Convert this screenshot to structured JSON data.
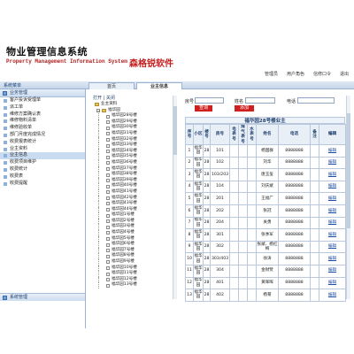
{
  "header": {
    "title": "物业管理信息系统",
    "subtitle": "Property Management Information System -",
    "brand": "森格锐软件",
    "links": [
      "管理员",
      "用户角色",
      "信修口令",
      "退出"
    ]
  },
  "strip": {
    "label": "系统菜单",
    "tabs": [
      "首页",
      "业主信息"
    ]
  },
  "sidebar": {
    "group": "业务管理",
    "items": [
      "客户投诉受理单",
      "派工单",
      "维修方案确认表",
      "维修物料清单",
      "维修验收单",
      "部门月度完成情况",
      "收费报表统计",
      "业主资料",
      "业主信息",
      "收费项目维护",
      "收费统计",
      "收费表",
      "收费提醒"
    ],
    "active_index": 8,
    "bottom_group": "系统管理"
  },
  "tree": {
    "tools": "打开 | 关闭",
    "root": "业主资料",
    "building": "福华园",
    "leaves": [
      "福华园28号楼",
      "福华园29号楼",
      "福华园30号楼",
      "福华园31号楼",
      "福华园32号楼",
      "福华园33号楼",
      "福华园34号楼",
      "福华园35号楼",
      "福华园36号楼",
      "福华园37号楼",
      "福华园38号楼",
      "福华园39号楼",
      "福华园40号楼",
      "福华园41号楼",
      "福华园42号楼",
      "福华园43号楼",
      "福华园44号楼",
      "福华园1号楼",
      "福华园2号楼",
      "福华园3号楼",
      "福华园4号楼",
      "福华园5号楼",
      "福华园6号楼",
      "福华园7号楼",
      "福华园8号楼",
      "福华园9号楼",
      "福华园10号楼",
      "福华园11号楼",
      "福华园12号楼",
      "福华园13号楼"
    ]
  },
  "filter": {
    "room_label": "房号",
    "name_label": "姓名",
    "phone_label": "电话",
    "room_value": "",
    "name_value": "",
    "phone_value": "",
    "search_label": "查询",
    "add_label": "添加"
  },
  "table": {
    "title": "福华园28号楼业主",
    "headers": [
      "序号",
      "小区",
      "楼号",
      "房号",
      "电表号",
      "煤气表号",
      "水表号",
      "姓名",
      "电话",
      "备注",
      "编辑"
    ],
    "rows": [
      [
        "1",
        "福华园",
        "28",
        "101",
        "",
        "",
        "",
        "杨国群",
        "8888888",
        "",
        "编辑"
      ],
      [
        "2",
        "福华园",
        "28",
        "102",
        "",
        "",
        "",
        "刘华",
        "8888888",
        "",
        "编辑"
      ],
      [
        "3",
        "福华园",
        "28",
        "103/203",
        "",
        "",
        "",
        "唐玉玺",
        "8888888",
        "",
        "编辑"
      ],
      [
        "4",
        "福华园",
        "28",
        "104",
        "",
        "",
        "",
        "刘庆斌",
        "8888888",
        "",
        "编辑"
      ],
      [
        "5",
        "福华园",
        "28",
        "201",
        "",
        "",
        "",
        "王福广",
        "8888888",
        "",
        "编辑"
      ],
      [
        "6",
        "福华园",
        "28",
        "202",
        "",
        "",
        "",
        "张冠",
        "8888888",
        "",
        "编辑"
      ],
      [
        "7",
        "福华园",
        "28",
        "204",
        "",
        "",
        "",
        "关勇",
        "8888888",
        "",
        "编辑"
      ],
      [
        "8",
        "福华园",
        "28",
        "301",
        "",
        "",
        "",
        "张季军",
        "8888888",
        "",
        "编辑"
      ],
      [
        "9",
        "福华园",
        "28",
        "302",
        "",
        "",
        "",
        "张斌、杨红梅",
        "8888888",
        "",
        "编辑"
      ],
      [
        "10",
        "福华园",
        "28",
        "303/403",
        "",
        "",
        "",
        "徐涛",
        "8888888",
        "",
        "编辑"
      ],
      [
        "11",
        "福华园",
        "28",
        "304",
        "",
        "",
        "",
        "金财赞",
        "8888888",
        "",
        "编辑"
      ],
      [
        "12",
        "福华园",
        "28",
        "401",
        "",
        "",
        "",
        "黄晖晖",
        "8888888",
        "",
        "编辑"
      ],
      [
        "13",
        "福华园",
        "28",
        "402",
        "",
        "",
        "",
        "杨菊",
        "8888888",
        "",
        "编辑"
      ]
    ]
  },
  "colors": {
    "brand_red": "#c61e1e",
    "link_blue": "#1f4fa3",
    "header_blue": "#1d3f6e"
  }
}
